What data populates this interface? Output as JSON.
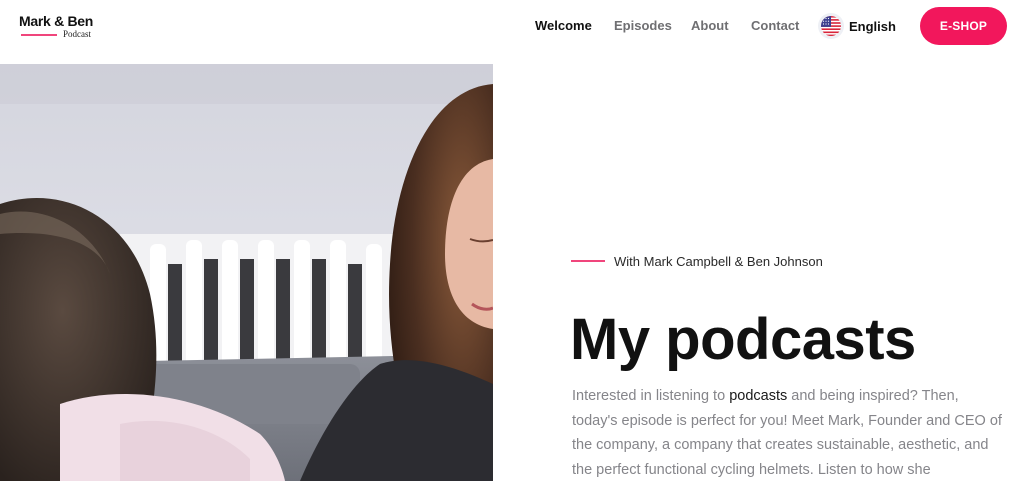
{
  "logo": {
    "name": "Mark & Ben",
    "sub": "Podcast"
  },
  "nav": {
    "items": [
      "Welcome",
      "Episodes",
      "About",
      "Contact"
    ],
    "active": "Welcome"
  },
  "language": {
    "label": "English",
    "icon": "us-flag-icon"
  },
  "eshop": {
    "label": "E-SHOP"
  },
  "hero": {
    "eyebrow": "With Mark Campbell & Ben Johnson",
    "title": "My podcasts",
    "para_before": "Interested in listening to ",
    "para_highlight": "podcasts",
    "para_after": " and being inspired? Then, today's episode is perfect for you! Meet Mark, Founder and CEO of the company, a company that creates sustainable, aesthetic, and the perfect functional cycling helmets. Listen to how she"
  },
  "colors": {
    "accent": "#f2175c",
    "accent_line": "#f0457c",
    "text_dark": "#111111",
    "text_muted": "#85858a"
  }
}
